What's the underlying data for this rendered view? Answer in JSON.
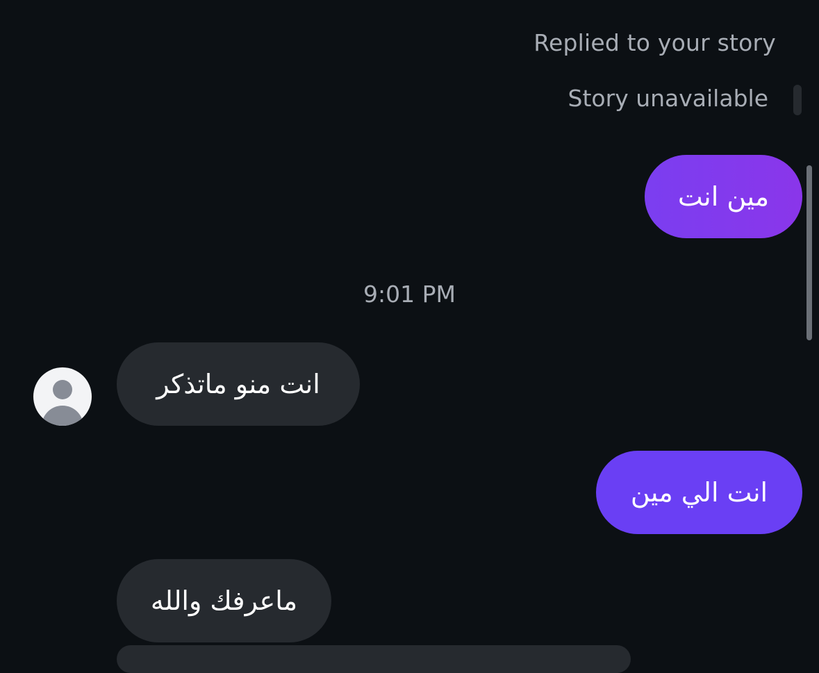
{
  "conversation": {
    "story_reply": {
      "label": "Replied to your story",
      "status": "Story unavailable"
    },
    "messages": [
      {
        "direction": "sent",
        "text": "مين انت"
      },
      {
        "direction": "received",
        "text": "انت منو ماتذكر"
      },
      {
        "direction": "sent",
        "text": "انت الي مين"
      },
      {
        "direction": "received",
        "text": "ماعرفك والله"
      }
    ],
    "timestamp": "9:01 PM"
  },
  "colors": {
    "background": "#0c1014",
    "sent_bubble": "#7b3ef0",
    "received_bubble": "#262a2f",
    "meta_text": "#a8adb5"
  },
  "icons": {
    "avatar": "default-user-icon"
  }
}
